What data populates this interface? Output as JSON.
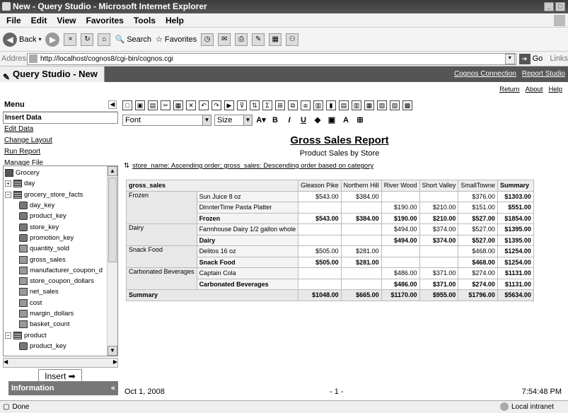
{
  "window": {
    "title": "New - Query Studio - Microsoft Internet Explorer"
  },
  "menubar": [
    "File",
    "Edit",
    "View",
    "Favorites",
    "Tools",
    "Help"
  ],
  "toolbar": {
    "back": "Back",
    "search": "Search",
    "favorites": "Favorites"
  },
  "address": {
    "label": "Address",
    "url": "http://localhost/cognos8/cgi-bin/cognos.cgi",
    "go": "Go",
    "links": "Links"
  },
  "app": {
    "tab_title": "Query Studio - New",
    "cognos_connection": "Cognos Connection",
    "report_studio": "Report Studio"
  },
  "toplinks": {
    "return": "Return",
    "about": "About",
    "help": "Help"
  },
  "sidebar": {
    "menu_title": "Menu",
    "items": [
      "Insert Data",
      "Edit Data",
      "Change Layout",
      "Run Report",
      "Manage File"
    ],
    "tree": [
      {
        "label": "Grocery",
        "level": 0,
        "type": "pkg",
        "exp": ""
      },
      {
        "label": "day",
        "level": 0,
        "type": "tbl",
        "exp": "+"
      },
      {
        "label": "grocery_store_facts",
        "level": 0,
        "type": "tbl",
        "exp": "−"
      },
      {
        "label": "day_key",
        "level": 1,
        "type": "key",
        "exp": ""
      },
      {
        "label": "product_key",
        "level": 1,
        "type": "key",
        "exp": ""
      },
      {
        "label": "store_key",
        "level": 1,
        "type": "key",
        "exp": ""
      },
      {
        "label": "promotion_key",
        "level": 1,
        "type": "key",
        "exp": ""
      },
      {
        "label": "quantity_sold",
        "level": 1,
        "type": "fld",
        "exp": ""
      },
      {
        "label": "gross_sales",
        "level": 1,
        "type": "fld",
        "exp": ""
      },
      {
        "label": "manufacturer_coupon_d",
        "level": 1,
        "type": "fld",
        "exp": ""
      },
      {
        "label": "store_coupon_dollars",
        "level": 1,
        "type": "fld",
        "exp": ""
      },
      {
        "label": "net_sales",
        "level": 1,
        "type": "fld",
        "exp": ""
      },
      {
        "label": "cost",
        "level": 1,
        "type": "fld",
        "exp": ""
      },
      {
        "label": "margin_dollars",
        "level": 1,
        "type": "fld",
        "exp": ""
      },
      {
        "label": "basket_count",
        "level": 1,
        "type": "fld",
        "exp": ""
      },
      {
        "label": "product",
        "level": 0,
        "type": "tbl",
        "exp": "−"
      },
      {
        "label": "product_key",
        "level": 1,
        "type": "key",
        "exp": ""
      }
    ],
    "insert": "Insert ➡",
    "information": "Information"
  },
  "format": {
    "font": "Font",
    "size": "Size"
  },
  "report": {
    "title": "Gross Sales Report",
    "subtitle": "Product Sales by Store",
    "sort": "store_name: Ascending order; gross_sales: Descending order based on category",
    "corner": "gross_sales",
    "columns": [
      "Gleason Pike",
      "Northern Hill",
      "River Wood",
      "Short Valley",
      "SmallTowne",
      "Summary"
    ],
    "rows": [
      {
        "cat": "Frozen",
        "item": "Sun Juice 8 oz",
        "vals": [
          "$543.00",
          "$384.00",
          "",
          "",
          "$376.00",
          "$1303.00"
        ],
        "kind": "item"
      },
      {
        "cat": "",
        "item": "DinnterTime Pasta Platter",
        "vals": [
          "",
          "",
          "$190.00",
          "$210.00",
          "$151.00",
          "$551.00"
        ],
        "kind": "item"
      },
      {
        "cat": "",
        "item": "Frozen",
        "vals": [
          "$543.00",
          "$384.00",
          "$190.00",
          "$210.00",
          "$527.00",
          "$1854.00"
        ],
        "kind": "sub"
      },
      {
        "cat": "Dairy",
        "item": "Farmhouse Dairy 1/2 gallon whole",
        "vals": [
          "",
          "",
          "$494.00",
          "$374.00",
          "$527.00",
          "$1395.00"
        ],
        "kind": "item"
      },
      {
        "cat": "",
        "item": "Dairy",
        "vals": [
          "",
          "",
          "$494.00",
          "$374.00",
          "$527.00",
          "$1395.00"
        ],
        "kind": "sub"
      },
      {
        "cat": "Snack Food",
        "item": "Delitos 16 oz",
        "vals": [
          "$505.00",
          "$281.00",
          "",
          "",
          "$468.00",
          "$1254.00"
        ],
        "kind": "item"
      },
      {
        "cat": "",
        "item": "Snack Food",
        "vals": [
          "$505.00",
          "$281.00",
          "",
          "",
          "$468.00",
          "$1254.00"
        ],
        "kind": "sub"
      },
      {
        "cat": "Carbonated Beverages",
        "item": "Captain Cola",
        "vals": [
          "",
          "",
          "$486.00",
          "$371.00",
          "$274.00",
          "$1131.00"
        ],
        "kind": "item"
      },
      {
        "cat": "",
        "item": "Carbonated Beverages",
        "vals": [
          "",
          "",
          "$486.00",
          "$371.00",
          "$274.00",
          "$1131.00"
        ],
        "kind": "sub"
      }
    ],
    "summary": {
      "label": "Summary",
      "vals": [
        "$1048.00",
        "$665.00",
        "$1170.00",
        "$955.00",
        "$1796.00",
        "$5634.00"
      ]
    }
  },
  "footer": {
    "date": "Oct 1, 2008",
    "page": "- 1 -",
    "time": "7:54:48 PM"
  },
  "status": {
    "text": "Done",
    "zone": "Local intranet"
  }
}
